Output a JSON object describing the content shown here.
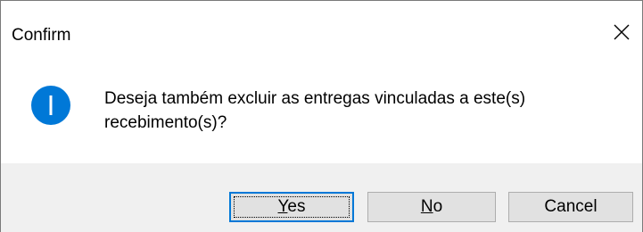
{
  "window": {
    "title": "Confirm",
    "close_icon": "close-icon"
  },
  "message": {
    "icon": "info-icon",
    "icon_color": "#0078d7",
    "text": "Deseja também excluir as entregas vinculadas a este(s) recebimento(s)?"
  },
  "buttons": {
    "yes": {
      "accel": "Y",
      "rest": "es"
    },
    "no": {
      "accel": "N",
      "rest": "o"
    },
    "cancel": {
      "label": "Cancel"
    }
  }
}
